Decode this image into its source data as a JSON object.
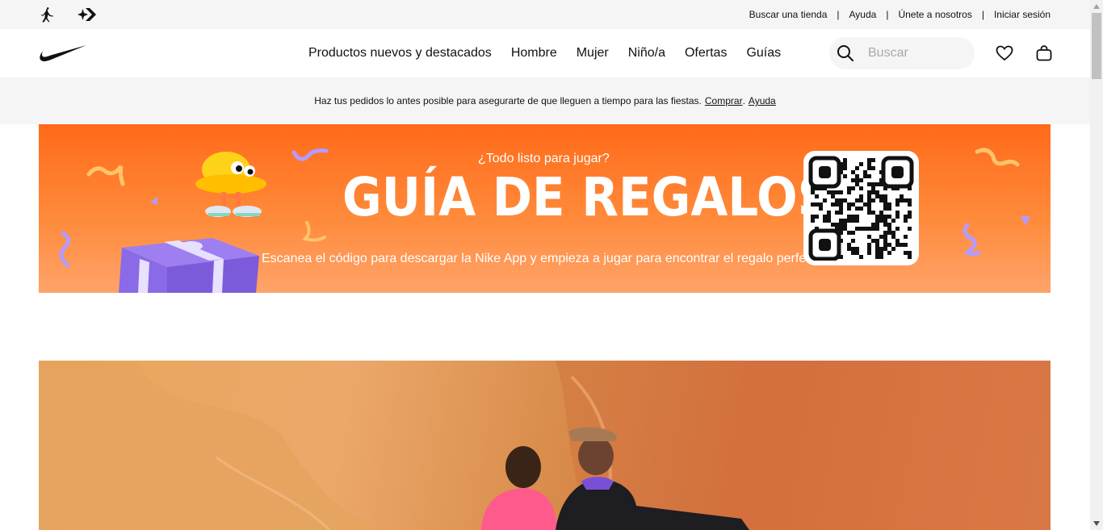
{
  "utility_bar": {
    "links": [
      "Buscar una tienda",
      "Ayuda",
      "Únete a nosotros",
      "Iniciar sesión"
    ],
    "separator": "|"
  },
  "nav": {
    "items": [
      "Productos nuevos y destacados",
      "Hombre",
      "Mujer",
      "Niño/a",
      "Ofertas",
      "Guías"
    ]
  },
  "search": {
    "placeholder": "Buscar"
  },
  "promo": {
    "text": "Haz tus pedidos lo antes posible para asegurarte de que lleguen a tiempo para las fiestas.",
    "link_shop": "Comprar",
    "link_help": "Ayuda"
  },
  "banner": {
    "kicker": "¿Todo listo para jugar?",
    "title": "GUÍA DE REGALOS",
    "description": "Escanea el código para descargar la Nike App y empieza a jugar para encontrar el regalo perfe"
  },
  "icons": {
    "jordan": "jordan-logo-icon",
    "converse": "converse-logo-icon",
    "nike": "nike-swoosh-icon",
    "search": "search-icon",
    "favorites": "heart-icon",
    "bag": "bag-icon"
  },
  "colors": {
    "banner_top": "#ff6a1a",
    "banner_bottom": "#ffa36a",
    "utility_bg": "#f5f5f5"
  }
}
